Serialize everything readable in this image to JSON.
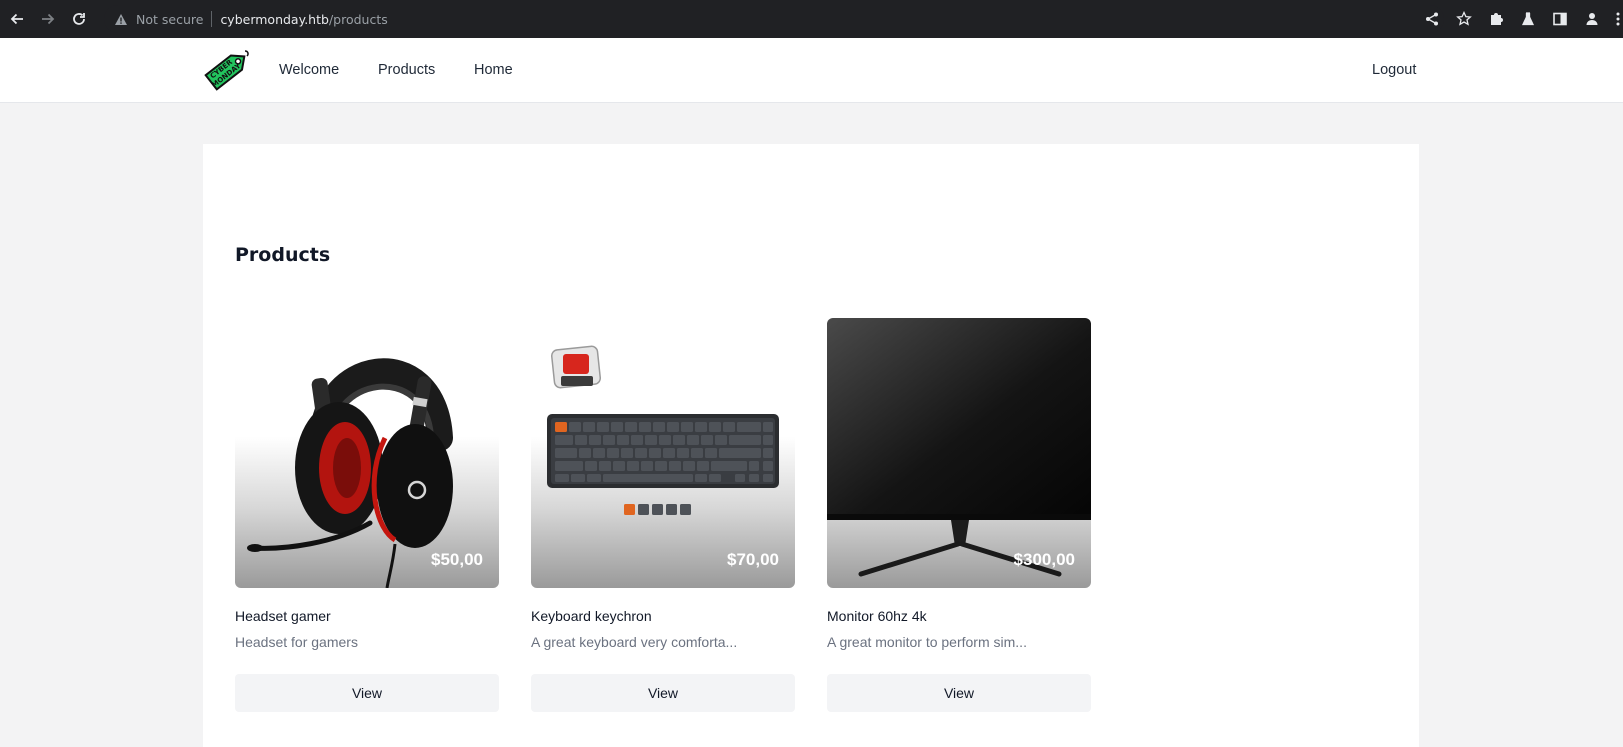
{
  "browser": {
    "security_label": "Not secure",
    "url_host": "cybermonday.htb",
    "url_path": "/products"
  },
  "header": {
    "logo_text": "CYBER MONDAY",
    "nav": {
      "welcome": "Welcome",
      "products": "Products",
      "home": "Home"
    },
    "logout": "Logout"
  },
  "main": {
    "title": "Products",
    "products": [
      {
        "name": "Headset gamer",
        "description": "Headset for gamers",
        "price": "$50,00",
        "view_label": "View"
      },
      {
        "name": "Keyboard keychron",
        "description": "A great keyboard very comforta...",
        "price": "$70,00",
        "view_label": "View"
      },
      {
        "name": "Monitor 60hz 4k",
        "description": "A great monitor to perform sim...",
        "price": "$300,00",
        "view_label": "View"
      }
    ]
  },
  "colors": {
    "chrome_bg": "#202124",
    "panel_bg": "#ffffff",
    "page_bg": "#f3f3f4",
    "logo_green": "#22c55e",
    "button_bg": "#f3f4f6"
  }
}
